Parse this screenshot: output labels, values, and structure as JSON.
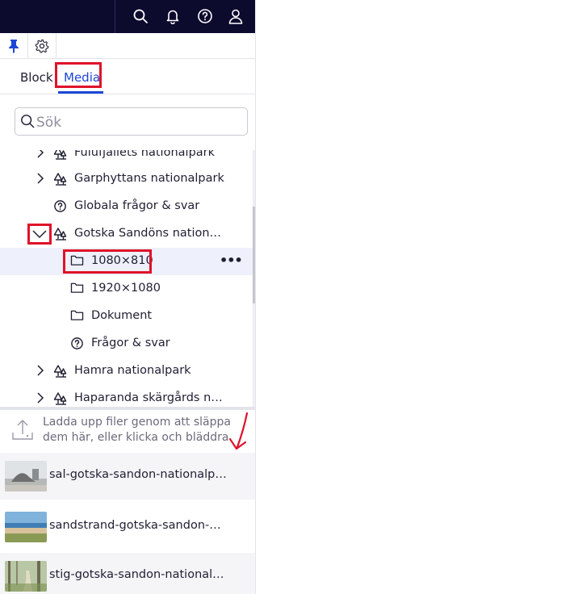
{
  "header": {
    "icons": [
      "search-icon",
      "bell-icon",
      "help-icon",
      "user-icon"
    ]
  },
  "toolbar": {
    "icons": [
      "pin-icon",
      "gear-icon"
    ]
  },
  "tabs": [
    {
      "label": "Block",
      "active": false
    },
    {
      "label": "Media",
      "active": true
    }
  ],
  "search": {
    "placeholder": "Sök"
  },
  "tree": [
    {
      "label": "Fulufjällets nationalpark",
      "icon": "park-icon",
      "chevron": "right",
      "level": 0
    },
    {
      "label": "Garphyttans nationalpark",
      "icon": "park-icon",
      "chevron": "right",
      "level": 0
    },
    {
      "label": "Globala frågor & svar",
      "icon": "question-icon",
      "chevron": "none",
      "level": 0
    },
    {
      "label": "Gotska Sandöns nation…",
      "icon": "park-icon",
      "chevron": "down",
      "level": 0
    },
    {
      "label": "1080×810",
      "icon": "folder-icon",
      "chevron": "none",
      "level": 1,
      "selected": true
    },
    {
      "label": "1920×1080",
      "icon": "folder-icon",
      "chevron": "none",
      "level": 1
    },
    {
      "label": "Dokument",
      "icon": "folder-icon",
      "chevron": "none",
      "level": 1
    },
    {
      "label": "Frågor & svar",
      "icon": "question-icon",
      "chevron": "none",
      "level": 1
    },
    {
      "label": "Hamra nationalpark",
      "icon": "park-icon",
      "chevron": "right",
      "level": 0
    },
    {
      "label": "Haparanda skärgårds n…",
      "icon": "park-icon",
      "chevron": "right",
      "level": 0
    }
  ],
  "row_actions": "•••",
  "upload": {
    "text": "Ladda upp filer genom att släppa dem här, eller klicka och bläddra"
  },
  "media": [
    {
      "name": "sal-gotska-sandon-nationalp…"
    },
    {
      "name": "sandstrand-gotska-sandon-…"
    },
    {
      "name": "stig-gotska-sandon-national…"
    }
  ],
  "colors": {
    "topbar": "#0c0b2e",
    "accent": "#1c47d6",
    "highlight_box": "#e0112a",
    "selected_row": "#eef0fb"
  }
}
